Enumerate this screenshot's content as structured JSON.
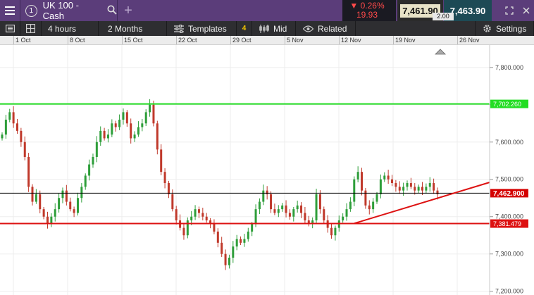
{
  "header": {
    "tab_number": "1",
    "instrument": "UK 100 - Cash",
    "change_pct": "▼ 0.26%",
    "change_pts": "19.93",
    "sell_price": "7,461.90",
    "buy_price": "7,463.90",
    "spread": "2.00"
  },
  "toolbar": {
    "interval": "4 hours",
    "range": "2 Months",
    "templates_label": "Templates",
    "templates_count": "4",
    "price_type": "Mid",
    "related_label": "Related",
    "settings_label": "Settings"
  },
  "colors": {
    "header_bg": "#5b3d7a",
    "up_candle": "#2e9e3a",
    "down_candle": "#c0392b",
    "resistance": "#22dd22",
    "support": "#dd1111",
    "trendline": "#dd1111"
  },
  "date_labels": [
    "1 Oct",
    "8 Oct",
    "15 Oct",
    "22 Oct",
    "29 Oct",
    "5 Nov",
    "12 Nov",
    "19 Nov",
    "26 Nov"
  ],
  "chart_data": {
    "type": "line",
    "ylabel": "",
    "xlabel": "",
    "ylim": [
      7190,
      7860
    ],
    "y_ticks": [
      "7,800.000",
      "7,700.000",
      "7,600.000",
      "7,500.000",
      "7,400.000",
      "7,300.000",
      "7,200.000"
    ],
    "x_categories": [
      "1 Oct",
      "8 Oct",
      "15 Oct",
      "22 Oct",
      "29 Oct",
      "5 Nov",
      "12 Nov",
      "19 Nov",
      "26 Nov"
    ],
    "horizontal_lines": [
      {
        "name": "resistance",
        "value": 7702.26,
        "label": "7,702.260",
        "color": "#22dd22"
      },
      {
        "name": "current",
        "value": 7462.9,
        "label": "7,462.900",
        "color": "#000000"
      },
      {
        "name": "support",
        "value": 7381.479,
        "label": "7,381.479",
        "color": "#dd1111"
      }
    ],
    "trendline": {
      "from": {
        "x": "12 Nov",
        "y": 7382
      },
      "to": {
        "x": "26 Nov",
        "y": 7492
      }
    },
    "series": [
      {
        "values": [
          7620,
          7660,
          7680,
          7650,
          7630,
          7600,
          7560,
          7480,
          7440,
          7460,
          7420,
          7400,
          7380,
          7400,
          7420,
          7450,
          7470,
          7440,
          7420,
          7410,
          7450,
          7480,
          7510,
          7540,
          7560,
          7600,
          7630,
          7610,
          7620,
          7650,
          7640,
          7660,
          7680,
          7650,
          7610,
          7620,
          7640,
          7650,
          7680,
          7700,
          7650,
          7580,
          7520,
          7490,
          7460,
          7420,
          7390,
          7370,
          7350,
          7390,
          7400,
          7420,
          7410,
          7400,
          7390,
          7380,
          7360,
          7330,
          7300,
          7270,
          7290,
          7320,
          7340,
          7330,
          7340,
          7360,
          7380,
          7420,
          7440,
          7470,
          7460,
          7420,
          7410,
          7420,
          7430,
          7410,
          7400,
          7420,
          7430,
          7410,
          7390,
          7380,
          7390,
          7460,
          7420,
          7390,
          7370,
          7350,
          7370,
          7390,
          7400,
          7420,
          7440,
          7500,
          7520,
          7470,
          7430,
          7420,
          7440,
          7460,
          7500,
          7510,
          7500,
          7490,
          7480,
          7470,
          7480,
          7490,
          7480,
          7470,
          7480,
          7470,
          7480,
          7490,
          7470,
          7460
        ]
      }
    ]
  }
}
